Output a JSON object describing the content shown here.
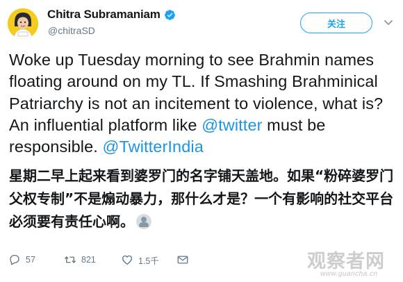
{
  "author": {
    "display_name": "Chitra Subramaniam",
    "handle": "@chitraSD",
    "verified": true
  },
  "follow_button": {
    "label": "关注"
  },
  "tweet": {
    "segments": [
      "Woke up Tuesday morning to see Brahmin names floating around on my TL. If Smashing Brahminical Patriarchy is not an incitement to violence, what is? An influential platform like ",
      "@twitter",
      " must be responsible. ",
      "@TwitterIndia"
    ],
    "translation": "星期二早上起来看到婆罗门的名字铺天盖地。如果“粉碎婆罗门父权专制”不是煽动暴力，那什么才是？一个有影响的社交平台必须要有责任心啊。"
  },
  "actions": {
    "replies": "57",
    "retweets": "821",
    "likes": "1.5千"
  },
  "watermark": {
    "brand": "观察者网",
    "url": "www.guancha.cn"
  },
  "colors": {
    "accent": "#1da1f2",
    "mention": "#1b95e0",
    "text": "#14171a",
    "muted": "#657786",
    "avatar_bg": "#f3cc1e"
  },
  "icons": [
    "verified-badge-icon",
    "caret-down-icon",
    "reply-icon",
    "retweet-icon",
    "like-icon",
    "envelope-icon",
    "user-face-emoji-icon"
  ]
}
